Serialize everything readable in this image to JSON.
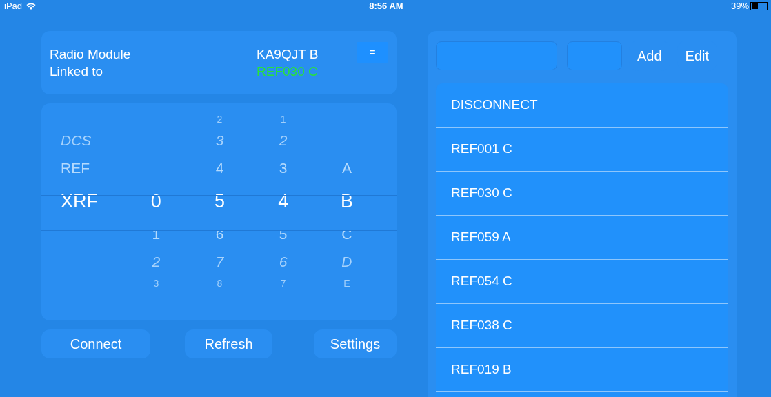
{
  "status_bar": {
    "device": "iPad",
    "time": "8:56 AM",
    "battery": "39%"
  },
  "module_card": {
    "labels": [
      "Radio Module",
      "Linked to"
    ],
    "callsign": "KA9QJT B",
    "linked": "REF030 C",
    "menu_button": "="
  },
  "picker": {
    "columns": [
      {
        "items": [
          {
            "label": "DCS",
            "selected": false
          },
          {
            "label": "REF",
            "selected": false
          },
          {
            "label": "XRF",
            "selected": true
          }
        ]
      },
      {
        "items": [
          {
            "label": "0",
            "selected": true
          },
          {
            "label": "1",
            "selected": false
          },
          {
            "label": "2",
            "selected": false
          },
          {
            "label": "3",
            "selected": false
          }
        ]
      },
      {
        "items": [
          {
            "label": "2",
            "selected": false
          },
          {
            "label": "3",
            "selected": false
          },
          {
            "label": "4",
            "selected": false
          },
          {
            "label": "5",
            "selected": true
          },
          {
            "label": "6",
            "selected": false
          },
          {
            "label": "7",
            "selected": false
          },
          {
            "label": "8",
            "selected": false
          }
        ]
      },
      {
        "items": [
          {
            "label": "1",
            "selected": false
          },
          {
            "label": "2",
            "selected": false
          },
          {
            "label": "3",
            "selected": false
          },
          {
            "label": "4",
            "selected": true
          },
          {
            "label": "5",
            "selected": false
          },
          {
            "label": "6",
            "selected": false
          },
          {
            "label": "7",
            "selected": false
          }
        ]
      },
      {
        "items": [
          {
            "label": "A",
            "selected": false
          },
          {
            "label": "B",
            "selected": true
          },
          {
            "label": "C",
            "selected": false
          },
          {
            "label": "D",
            "selected": false
          },
          {
            "label": "E",
            "selected": false
          }
        ]
      }
    ]
  },
  "buttons": [
    "Connect",
    "Refresh",
    "Settings"
  ],
  "right_panel": {
    "add_button": "Add",
    "edit_button": "Edit",
    "reflectors": [
      "DISCONNECT",
      "REF001 C",
      "REF030 C",
      "REF059 A",
      "REF054 C",
      "REF038 C",
      "REF019 B"
    ]
  }
}
